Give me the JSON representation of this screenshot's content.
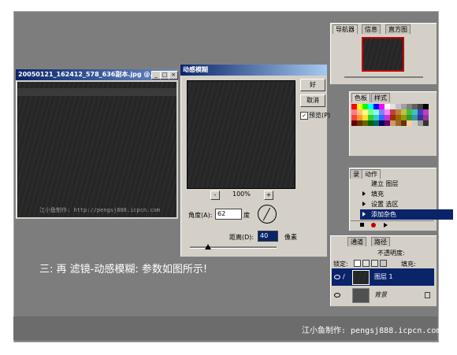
{
  "document_window": {
    "title": "20050121_162412_578_636副本.jpg @...",
    "watermark": "江小鱼制作: http://pengsj888.icpcn.com"
  },
  "dialog": {
    "title": "动感模糊",
    "ok_label": "好",
    "cancel_label": "取消",
    "preview_label": "预览(P)",
    "preview_checked": true,
    "zoom_minus": "-",
    "zoom_level": "100%",
    "zoom_plus": "+",
    "angle_label": "角度(A):",
    "angle_value": "62",
    "angle_unit": "度",
    "distance_label": "距离(D):",
    "distance_value": "40",
    "distance_unit": "像素"
  },
  "navigator_panel": {
    "tabs": [
      "导航器",
      "信息",
      "直方图"
    ]
  },
  "swatches_panel": {
    "tabs": [
      "色板",
      "样式"
    ],
    "colors": [
      "#ff0000",
      "#ffff00",
      "#00ff00",
      "#00ffff",
      "#0000ff",
      "#ff00ff",
      "#ffffff",
      "#e0e0e0",
      "#c0c0c0",
      "#a0a0a0",
      "#808080",
      "#606060",
      "#404040",
      "#000000",
      "#ff8080",
      "#ffc080",
      "#ffff80",
      "#80ff80",
      "#80ffff",
      "#8080ff",
      "#ff80ff",
      "#c04040",
      "#c08040",
      "#c0c040",
      "#40c040",
      "#40c0c0",
      "#4040c0",
      "#c040c0",
      "#ff4040",
      "#ff9933",
      "#ffe033",
      "#33cc33",
      "#33cccc",
      "#3366ff",
      "#cc33cc",
      "#993300",
      "#996600",
      "#999900",
      "#339933",
      "#339999",
      "#333399",
      "#993399",
      "#660000",
      "#663300",
      "#666600",
      "#006600",
      "#006666",
      "#000066",
      "#660066",
      "#cc9966",
      "#996633",
      "#663300",
      "#ffcc99",
      "#cccccc",
      "#999999",
      "#333333"
    ]
  },
  "actions_panel": {
    "tabs": [
      "录",
      "动作"
    ],
    "items": [
      "建立 图层",
      "填充",
      "设置 选区",
      "添加杂色"
    ],
    "selected_index": 3
  },
  "layers_panel": {
    "tabs": [
      "通道",
      "路径"
    ],
    "opacity_label": "不透明度:",
    "lock_label": "锁定:",
    "fill_label": "填充:",
    "layers": [
      {
        "name": "图层 1",
        "selected": true
      },
      {
        "name": "背景",
        "selected": false
      }
    ]
  },
  "caption": "三: 再 滤镜-动感模糊: 参数如图所示!",
  "footer_credit": "江小鱼制作: pengsj888.icpcn.com"
}
